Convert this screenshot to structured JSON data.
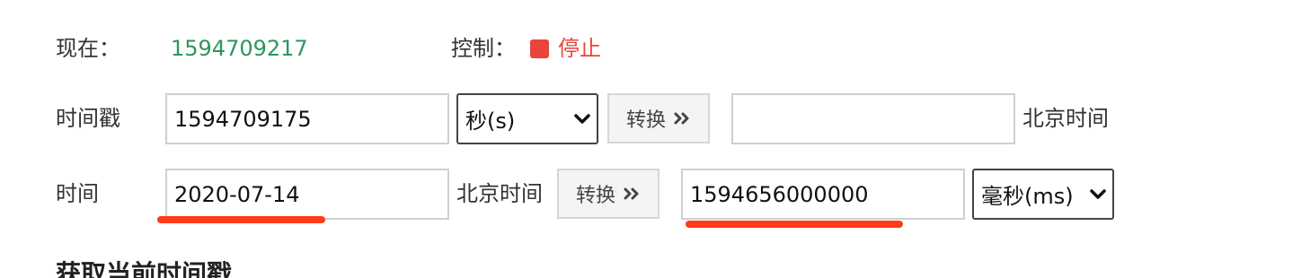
{
  "row_now": {
    "label": "现在：",
    "value": "1594709217",
    "control_label": "控制：",
    "stop_label": "停止",
    "stop_color": "#e8453c",
    "value_color": "#2b9660"
  },
  "row_timestamp": {
    "label": "时间戳",
    "input_value": "1594709175",
    "unit_select": "秒(s)",
    "convert_label": "转换",
    "convert_icon": "double-chevron-right-icon",
    "output_value": "",
    "output_suffix": "北京时间"
  },
  "row_time": {
    "label": "时间",
    "input_value": "2020-07-14",
    "input_suffix": "北京时间",
    "convert_label": "转换",
    "convert_icon": "double-chevron-right-icon",
    "output_value": "1594656000000",
    "unit_select": "毫秒(ms)"
  },
  "annotations": {
    "underline_color": "#ff3b1a"
  },
  "section": {
    "title": "获取当前时间戳"
  }
}
